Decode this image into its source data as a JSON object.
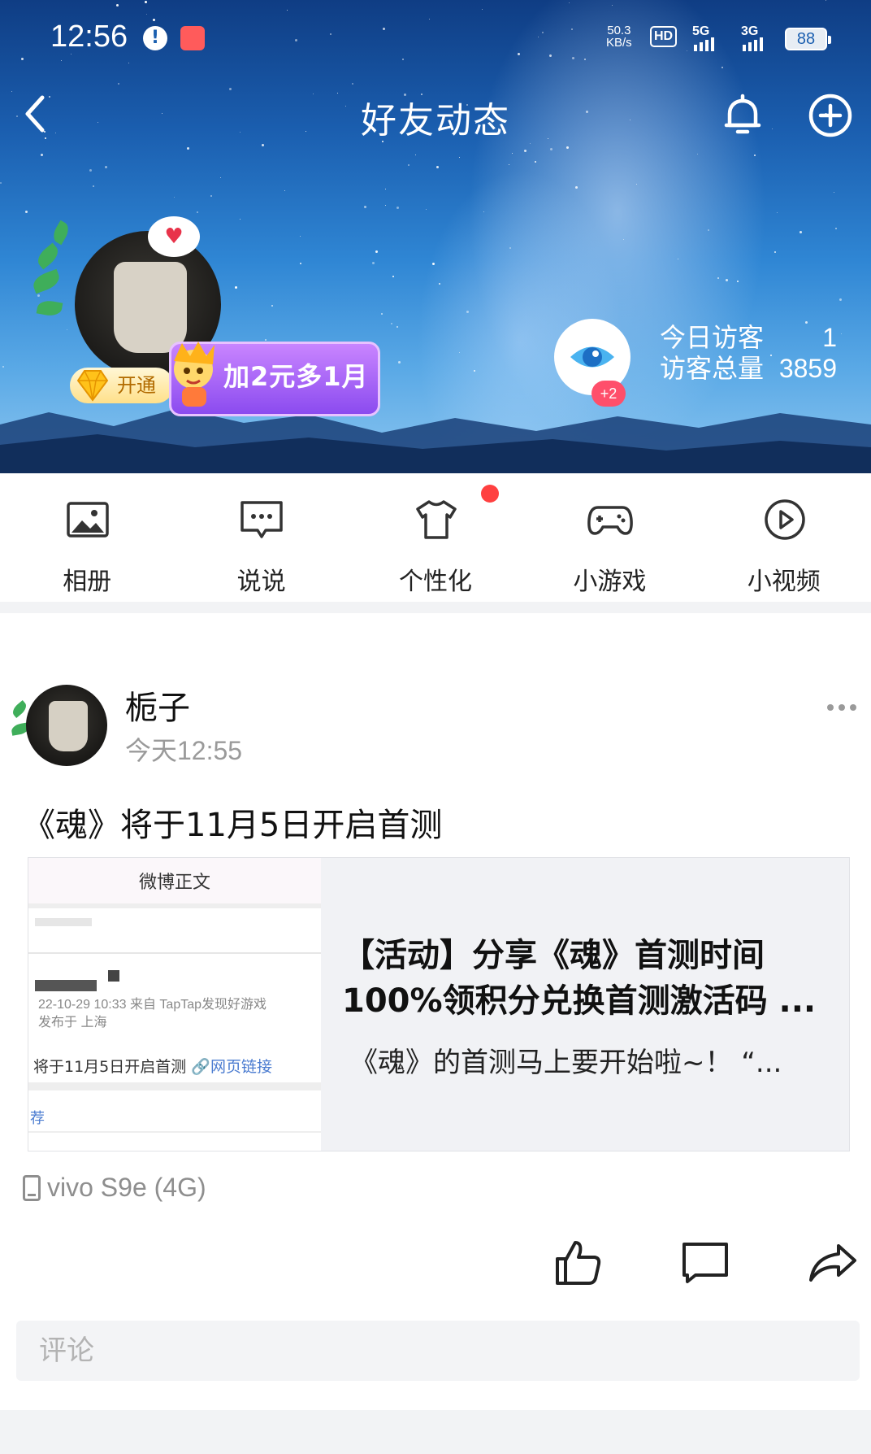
{
  "status_bar": {
    "time": "12:56",
    "speed_value": "50.3",
    "speed_unit": "KB/s",
    "hd": "HD",
    "net1": "5G",
    "net2": "3G",
    "battery": "88"
  },
  "header": {
    "title": "好友动态",
    "back_icon": "chevron-left-icon",
    "bell_icon": "bell-icon",
    "add_icon": "plus-circle-icon"
  },
  "profile": {
    "vip_label": "开通",
    "promo_label": "加2元多1月",
    "visitor_badge": "+2",
    "visitors": [
      {
        "label": "今日访客",
        "value": "1"
      },
      {
        "label": "访客总量",
        "value": "3859"
      }
    ]
  },
  "quick_nav": [
    {
      "label": "相册",
      "icon": "photo-icon"
    },
    {
      "label": "说说",
      "icon": "chat-bubble-icon"
    },
    {
      "label": "个性化",
      "icon": "shirt-icon"
    },
    {
      "label": "小游戏",
      "icon": "gamepad-icon"
    },
    {
      "label": "小视频",
      "icon": "play-circle-icon"
    }
  ],
  "post": {
    "author": "栀子",
    "time": "今天12:55",
    "text": "《魂》将于11月5日开启首测",
    "card": {
      "thumb_header": "微博正文",
      "thumb_meta1": "22-10-29 10:33  来自 TapTap发现好游戏",
      "thumb_meta2": "发布于 上海",
      "thumb_body": "将于11月5日开启首测 ",
      "thumb_link": "🔗网页链接",
      "thumb_tag": "荐",
      "title": "【活动】分享《魂》首测时间100%领积分兑换首测激活码 ...",
      "desc": "《魂》的首测马上要开始啦~！  “..."
    },
    "device": "vivo S9e (4G)",
    "comment_placeholder": "评论"
  },
  "colors": {
    "accent_red": "#ff4040",
    "promo_purple": "#8b4bef",
    "link_blue": "#4a7bd0"
  }
}
